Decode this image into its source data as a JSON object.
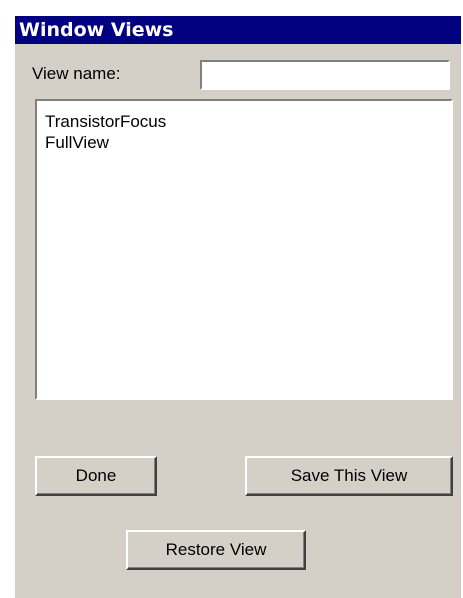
{
  "window": {
    "title": "Window Views"
  },
  "form": {
    "view_name_label": "View name:",
    "view_name_value": "",
    "view_name_placeholder": ""
  },
  "views_list": {
    "items": [
      {
        "label": "TransistorFocus"
      },
      {
        "label": "FullView"
      }
    ]
  },
  "buttons": {
    "done_label": "Done",
    "save_label": "Save This View",
    "restore_label": "Restore View"
  },
  "colors": {
    "titlebar": "#000080",
    "dialog_face": "#d4d0c8",
    "field_background": "#ffffff"
  }
}
